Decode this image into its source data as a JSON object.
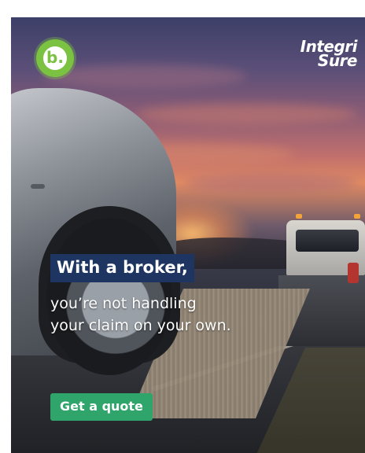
{
  "badge": {
    "letter": "b."
  },
  "brand": {
    "line1": "Integri",
    "line2": "Sure"
  },
  "headline": "With a broker,",
  "subline": {
    "line1": "you’re not handling",
    "line2": "your claim on your own."
  },
  "cta": {
    "label": "Get a quote"
  },
  "colors": {
    "headline_bg": "#1d3560",
    "cta_bg": "#2fa56b",
    "badge": "#7cc242"
  }
}
